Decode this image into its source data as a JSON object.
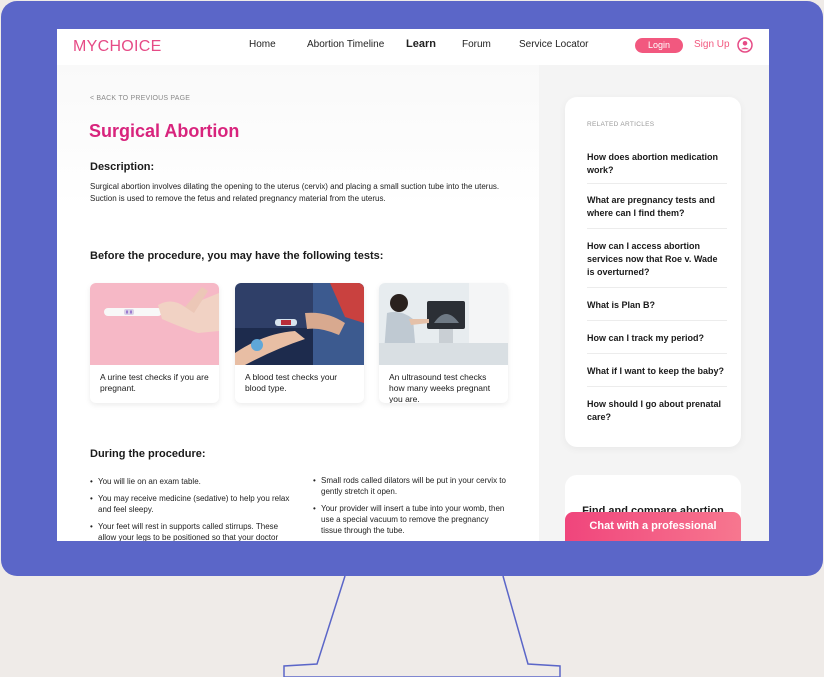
{
  "brand": {
    "logo": "MYCHOICE",
    "accent": "#e64b86",
    "monitor_color": "#5b66c8"
  },
  "nav": {
    "links": [
      "Home",
      "Abortion Timeline",
      "Learn",
      "Forum",
      "Service Locator"
    ],
    "active": "Learn",
    "login_label": "Login",
    "signup_label": "Sign Up",
    "user_icon": "user-circle-icon"
  },
  "article": {
    "back_label": "< BACK TO PREVIOUS PAGE",
    "title": "Surgical Abortion",
    "description_heading": "Description:",
    "description_text": "Surgical abortion involves dilating the opening to the uterus (cervix) and placing a small suction tube into the uterus. Suction is used to remove the fetus and related pregnancy material from the uterus.",
    "tests_heading": "Before the procedure, you may have the following tests:",
    "tests": [
      {
        "caption": "A urine test checks if you are pregnant."
      },
      {
        "caption": "A blood test checks your blood type."
      },
      {
        "caption": "An ultrasound test checks how many weeks pregnant you are."
      }
    ],
    "during_heading": "During the procedure:",
    "during_left": [
      "You will lie on an exam table.",
      "You may receive medicine (sedative) to help you relax and feel sleepy.",
      "Your feet will rest in supports called stirrups. These allow your legs to be positioned so that your doctor"
    ],
    "during_right": [
      "Small rods called dilators will be put in your cervix to gently stretch it open.",
      "Your provider will insert a tube into your womb, then use a special vacuum to remove the pregnancy tissue through the tube."
    ]
  },
  "sidebar": {
    "related_heading": "RELATED ARTICLES",
    "related": [
      "How does abortion medication work?",
      "What are pregnancy tests and where can I find them?",
      "How can I access abortion services now that Roe v. Wade is overturned?",
      "What is Plan B?",
      "How can I track my period?",
      "What if I want to keep the baby?",
      "How should I go about prenatal care?"
    ],
    "compare_text": "Find and compare abortion",
    "chat_label": "Chat with a professional"
  }
}
